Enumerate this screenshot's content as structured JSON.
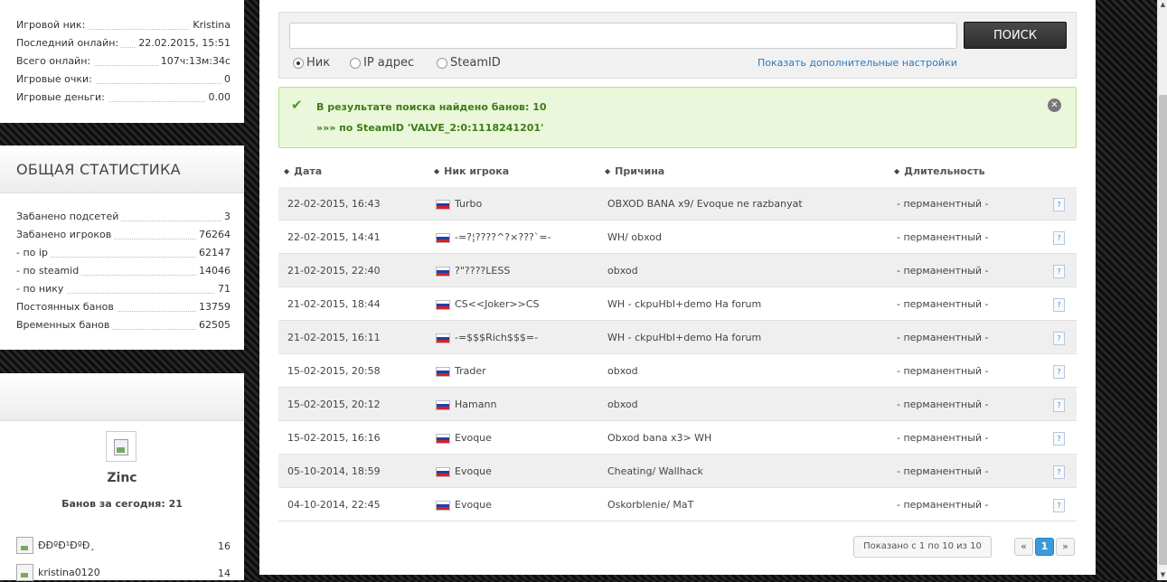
{
  "sidebar": {
    "profile": {
      "rows": [
        {
          "label": "Игровой ник:",
          "value": "Kristina"
        },
        {
          "label": "Последний онлайн:",
          "value": "22.02.2015, 15:51"
        },
        {
          "label": "Всего онлайн:",
          "value": "107ч:13м:34с"
        },
        {
          "label": "Игровые очки:",
          "value": "0"
        },
        {
          "label": "Игровые деньги:",
          "value": "0.00"
        }
      ]
    },
    "stats": {
      "title": "ОБЩАЯ СТАТИСТИКА",
      "rows": [
        {
          "label": "Забанено подсетей",
          "value": "3"
        },
        {
          "label": "Забанено игроков",
          "value": "76264"
        },
        {
          "label": "- по ip",
          "value": "62147"
        },
        {
          "label": "- по steamid",
          "value": "14046"
        },
        {
          "label": "- по нику",
          "value": "71"
        },
        {
          "label": "Постоянных банов",
          "value": "13759"
        },
        {
          "label": "Временных банов",
          "value": "62505"
        }
      ]
    },
    "top_admin": {
      "name": "Zinc",
      "today": "Банов за сегодня: 21",
      "list": [
        {
          "name": "ÐÐºÐ¹ÐºÐ¸",
          "count": "16"
        },
        {
          "name": "kristina0120",
          "count": "14"
        }
      ]
    }
  },
  "search": {
    "input_value": "",
    "button_label": "ПОИСК",
    "radios": [
      {
        "label": "Ник",
        "checked": true
      },
      {
        "label": "IP адрес",
        "checked": false
      },
      {
        "label": "SteamID",
        "checked": false
      }
    ],
    "advanced_link": "Показать дополнительные настройки"
  },
  "alert": {
    "line1": "В результате поиска найдено банов: 10",
    "line2": "»»» по SteamID 'VALVE_2:0:1118241201'",
    "icon": "check-icon",
    "close_glyph": "✕"
  },
  "table": {
    "columns": [
      "Дата",
      "Ник игрока",
      "Причина",
      "Длительность"
    ],
    "sort_glyph": "◆",
    "info_glyph": "?",
    "rows": [
      {
        "date": "22-02-2015, 16:43",
        "nick": "Turbo",
        "reason": "OBXOD BANA x9/ Evoque ne razbanyat",
        "length": "- перманентный -"
      },
      {
        "date": "22-02-2015, 14:41",
        "nick": "-=?¦????^?×???`=-",
        "reason": "WH/ obxod",
        "length": "- перманентный -"
      },
      {
        "date": "21-02-2015, 22:40",
        "nick": "?\"????LESS",
        "reason": "obxod",
        "length": "- перманентный -"
      },
      {
        "date": "21-02-2015, 18:44",
        "nick": "CS<<Joker>>CS",
        "reason": "WH - ckpuHbI+demo Ha forum",
        "length": "- перманентный -"
      },
      {
        "date": "21-02-2015, 16:11",
        "nick": "-=$$$Rich$$$=-",
        "reason": "WH - ckpuHbI+demo Ha forum",
        "length": "- перманентный -"
      },
      {
        "date": "15-02-2015, 20:58",
        "nick": "Trader",
        "reason": "obxod",
        "length": "- перманентный -"
      },
      {
        "date": "15-02-2015, 20:12",
        "nick": "Hamann",
        "reason": "obxod",
        "length": "- перманентный -"
      },
      {
        "date": "15-02-2015, 16:16",
        "nick": "Evoque",
        "reason": "Obxod bana x3> WH",
        "length": "- перманентный -"
      },
      {
        "date": "05-10-2014, 18:59",
        "nick": "Evoque",
        "reason": "Cheating/ Wallhack",
        "length": "- перманентный -"
      },
      {
        "date": "04-10-2014, 22:45",
        "nick": "Evoque",
        "reason": "Oskorblenie/ MaT",
        "length": "- перманентный -"
      }
    ]
  },
  "pagination": {
    "info": "Показано с 1 по 10 из 10",
    "prev": "«",
    "current": "1",
    "next": "»"
  },
  "scrollbar": {
    "up": "▲",
    "down": "▼"
  }
}
